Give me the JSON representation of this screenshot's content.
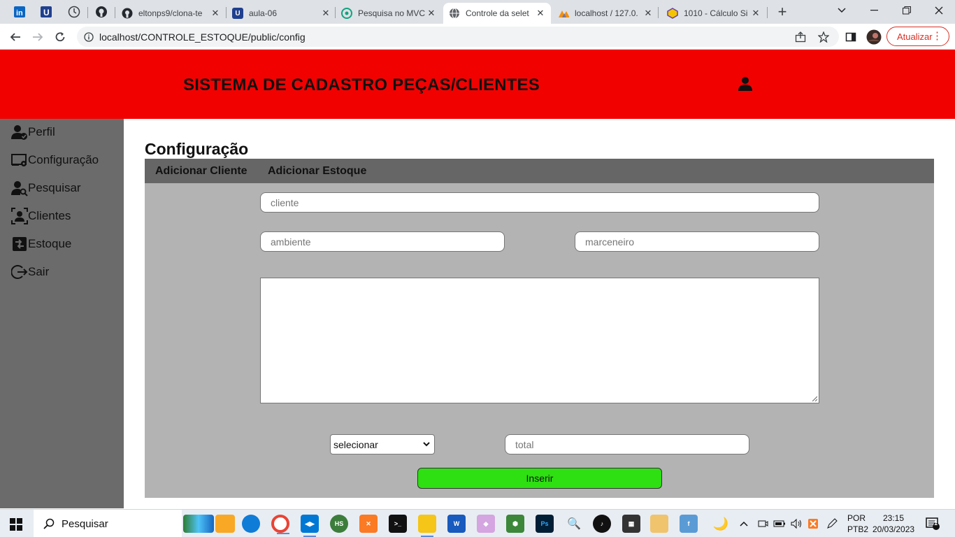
{
  "browser": {
    "tabs": [
      {
        "title": "eltonps9/clona-te",
        "icon": "github-icon"
      },
      {
        "title": "aula-06",
        "icon": "u-logo-icon"
      },
      {
        "title": "Pesquisa no MVC",
        "icon": "chatgpt-icon"
      },
      {
        "title": "Controle da selet",
        "icon": "globe-icon",
        "active": true
      },
      {
        "title": "localhost / 127.0.",
        "icon": "phpmyadmin-icon"
      },
      {
        "title": "1010 - Cálculo Si",
        "icon": "beecrowd-icon"
      }
    ],
    "url": "localhost/CONTROLE_ESTOQUE/public/config",
    "update_label": "Atualizar"
  },
  "header": {
    "title": "SISTEMA DE CADASTRO PEÇAS/CLIENTES"
  },
  "sidebar": {
    "items": [
      {
        "label": "Perfil",
        "icon": "user-check-icon"
      },
      {
        "label": "Configuração",
        "icon": "settings-screen-icon"
      },
      {
        "label": "Pesquisar",
        "icon": "user-search-icon"
      },
      {
        "label": "Clientes",
        "icon": "clients-icon"
      },
      {
        "label": "Estoque",
        "icon": "stock-icon"
      },
      {
        "label": "Sair",
        "icon": "logout-icon"
      }
    ]
  },
  "main": {
    "title": "Configuração",
    "tabs": [
      "Adicionar Cliente",
      "Adicionar Estoque"
    ],
    "form": {
      "cliente_placeholder": "cliente",
      "ambiente_placeholder": "ambiente",
      "marceneiro_placeholder": "marceneiro",
      "select_value": "selecionar",
      "total_placeholder": "total",
      "submit_label": "Inserir"
    }
  },
  "taskbar": {
    "search_label": "Pesquisar",
    "lang_line1": "POR",
    "lang_line2": "PTB2",
    "time": "23:15",
    "date": "20/03/2023",
    "notification_count": "1"
  },
  "colors": {
    "header_bg": "#f20101",
    "sidebar_bg": "#6b6b6b",
    "subnav_bg": "#666666",
    "form_bg": "#b3b3b3",
    "submit_bg": "#2ee012"
  }
}
